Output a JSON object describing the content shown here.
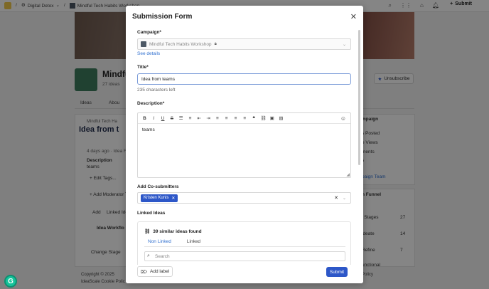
{
  "topbar": {
    "breadcrumb_1": "Digital Detox",
    "breadcrumb_2": "Mindful Tech Habits Workshop",
    "search_label": "Search",
    "submit_label": "Submit",
    "notification_count": "1"
  },
  "background": {
    "campaign_title": "Mindfu",
    "ideas_count": "27 ideas",
    "tabs": [
      "Ideas",
      "Abou"
    ],
    "unsubscribe_label": "Unsubscribe",
    "idea_crumb": "Mindful Tech Ha",
    "idea_title": "Idea from t",
    "idea_meta": "4 days ago · Idea F",
    "description_label": "Description",
    "description_value": "teams",
    "edit_tags": "+ Edit Tags...",
    "add_moderator": "+ Add Moderator T",
    "add_linked": "Add",
    "linked_ideas": "Linked Ide",
    "idea_workflow": "Idea Workflo",
    "change_stage": "Change Stage",
    "right_card_1": {
      "title": "mpaign",
      "rows": [
        "s Posted",
        "e Views",
        "ments",
        "s"
      ],
      "link": "paign Team"
    },
    "right_card_2": {
      "title": "n Funnel",
      "rows": [
        {
          "label": "l Stages",
          "value": "27"
        },
        {
          "label": "ideate",
          "value": "14"
        },
        {
          "label": "Refine",
          "value": "7"
        },
        {
          "label": "unctional",
          "value": ""
        }
      ]
    },
    "footer_1": "Copyright © 2025",
    "footer_2": "IdeaScale Cookie Polic",
    "footer_right": "Policy"
  },
  "modal": {
    "title": "Submission Form",
    "campaign": {
      "label": "Campaign",
      "value": "Mindful Tech Habits Workshop",
      "see_details": "See details"
    },
    "title_field": {
      "label": "Title",
      "value": "Idea from teams",
      "chars_left": "235 characters left"
    },
    "description": {
      "label": "Description",
      "value": "teams"
    },
    "co_submitters": {
      "label": "Add Co-submitters",
      "chips": [
        "Kristen Kunis"
      ]
    },
    "linked_ideas": {
      "label": "Linked Ideas",
      "similar_found": "39 similar ideas found",
      "tabs": [
        "Non Linked",
        "Linked"
      ],
      "search_placeholder": "Search"
    },
    "add_label": "Add label",
    "submit_label": "Submit"
  },
  "icons": {
    "toolbar": [
      "bold",
      "italic",
      "underline",
      "strikethrough",
      "bullet-list",
      "numbered-list",
      "outdent",
      "indent",
      "align-left",
      "align-center",
      "align-right",
      "align-justify",
      "quote",
      "link",
      "media",
      "image",
      "emoji"
    ]
  },
  "colors": {
    "accent": "#2d57c8",
    "link": "#2f6fcf",
    "focus": "#7a9bd8"
  }
}
